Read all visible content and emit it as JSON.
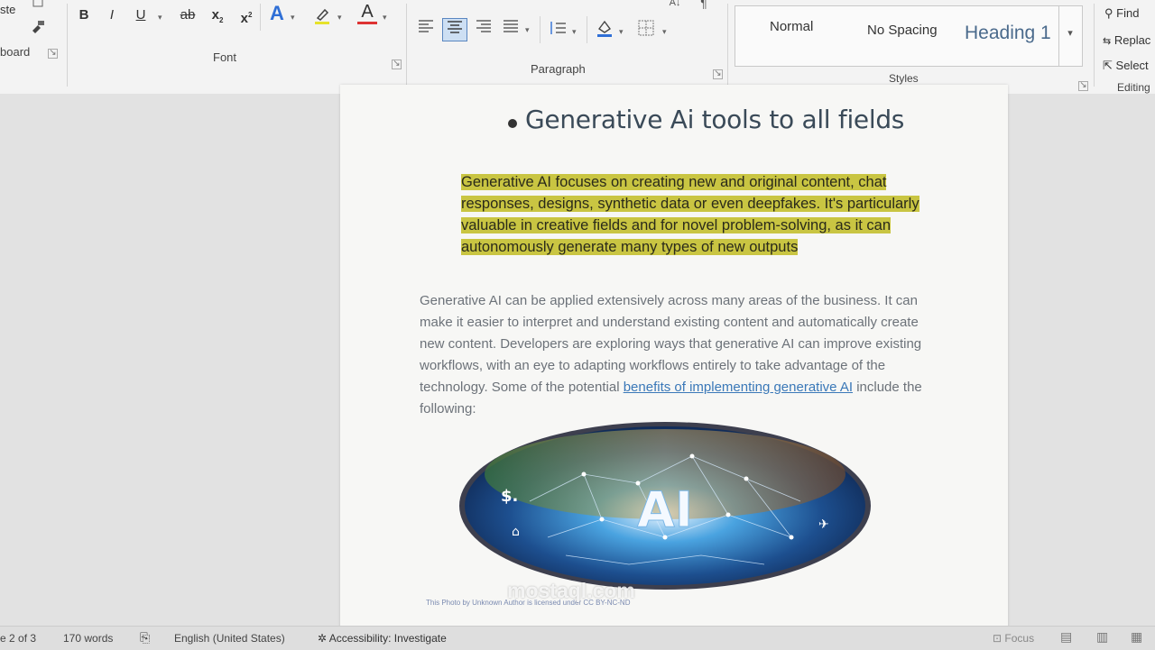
{
  "ribbon": {
    "clipboard": {
      "paste_label": "ste",
      "group_label": "board"
    },
    "font": {
      "group_label": "Font",
      "bold": "B",
      "italic": "I",
      "underline": "U",
      "strikethrough": "ab",
      "subscript": "x",
      "superscript": "x",
      "text_effects": "A",
      "font_color": "A"
    },
    "paragraph": {
      "group_label": "Paragraph"
    },
    "styles": {
      "group_label": "Styles",
      "items": [
        "Normal",
        "No Spacing",
        "Heading 1"
      ]
    },
    "editing": {
      "group_label": "Editing",
      "find": "Find",
      "replace": "Replac",
      "select": "Select"
    }
  },
  "document": {
    "heading": "Generative Ai tools to all fields",
    "highlighted_paragraph": "Generative AI focuses on creating new and original content, chat responses, designs, synthetic data or even deepfakes. It's particularly valuable in creative fields and for novel problem-solving, as it can autonomously generate many types of new outputs",
    "body_before_link": "Generative AI can be applied extensively across many areas of the business. It can make it easier to interpret and understand existing content and automatically create new content. Developers are exploring ways that generative AI can improve existing workflows, with an eye to adapting workflows entirely to take advantage of the technology. Some of the potential ",
    "body_link": "benefits of implementing generative AI",
    "body_after_link": " include the following:",
    "image_text": "AI",
    "caption": "This Photo by Unknown Author is licensed under CC BY-NC-ND",
    "watermark": "mostaql.com"
  },
  "statusbar": {
    "page": "e 2 of 3",
    "words": "170 words",
    "language": "English (United States)",
    "accessibility": "Accessibility: Investigate",
    "focus": "Focus"
  },
  "colors": {
    "highlight": "#c9c542",
    "link": "#3a78b8",
    "heading": "#3a4a58"
  }
}
